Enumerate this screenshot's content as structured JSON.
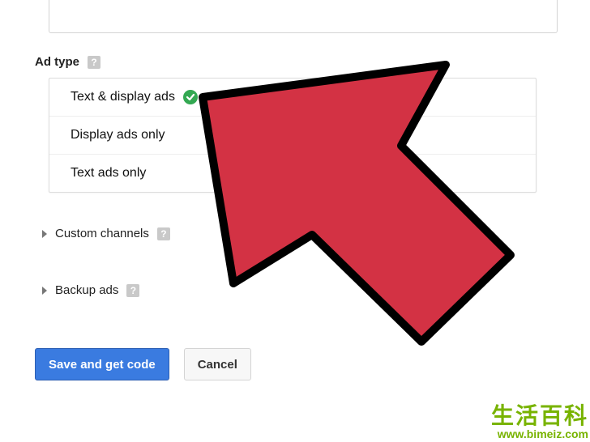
{
  "section": {
    "ad_type_label": "Ad type",
    "custom_channels_label": "Custom channels",
    "backup_ads_label": "Backup ads"
  },
  "options": {
    "text_display": "Text & display ads",
    "display_only": "Display ads only",
    "text_only": "Text ads only",
    "selected_index": 0
  },
  "buttons": {
    "save_label": "Save and get code",
    "cancel_label": "Cancel"
  },
  "help_glyph": "?",
  "watermark": {
    "title": "生活百科",
    "url": "www.bimeiz.com"
  }
}
